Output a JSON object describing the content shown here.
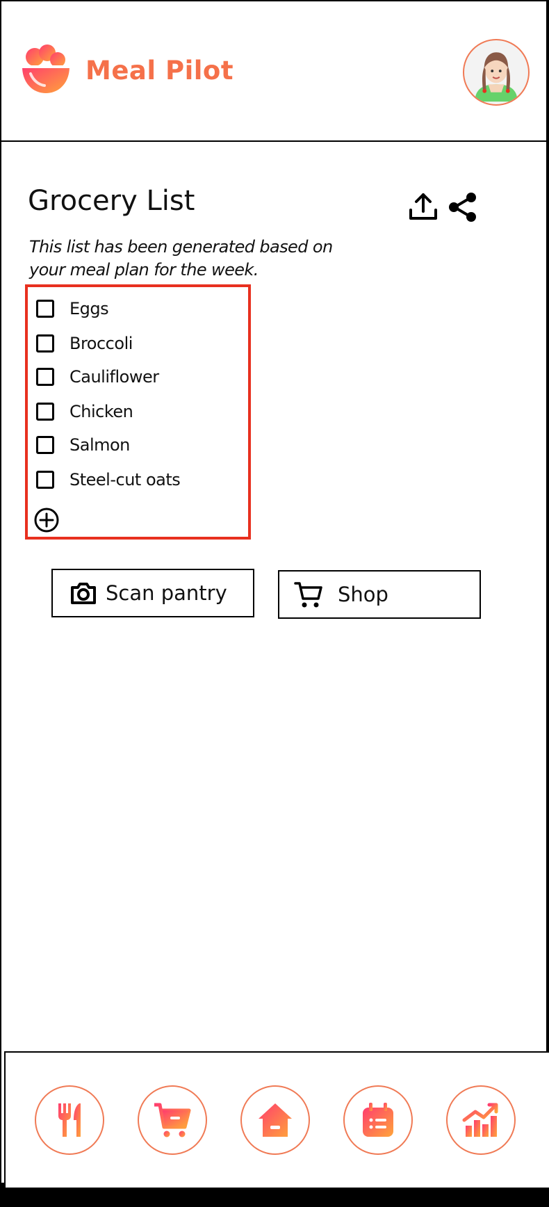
{
  "app": {
    "title": "Meal Pilot"
  },
  "colors": {
    "accent": "#f5714a",
    "highlight": "#e8301f",
    "gradient_start": "#ff3d6e",
    "gradient_end": "#ffa53a"
  },
  "page": {
    "title": "Grocery List",
    "subtitle": "This list has been generated based on your meal plan for the week."
  },
  "header_icons": [
    "upload-icon",
    "share-icon"
  ],
  "grocery_items": [
    {
      "label": "Eggs",
      "checked": false
    },
    {
      "label": "Broccoli",
      "checked": false
    },
    {
      "label": "Cauliflower",
      "checked": false
    },
    {
      "label": "Chicken",
      "checked": false
    },
    {
      "label": "Salmon",
      "checked": false
    },
    {
      "label": "Steel-cut oats",
      "checked": false
    }
  ],
  "actions": {
    "scan_label": "Scan pantry",
    "shop_label": "Shop"
  },
  "nav": [
    "utensils-icon",
    "cart-icon",
    "home-icon",
    "calendar-list-icon",
    "chart-icon"
  ]
}
